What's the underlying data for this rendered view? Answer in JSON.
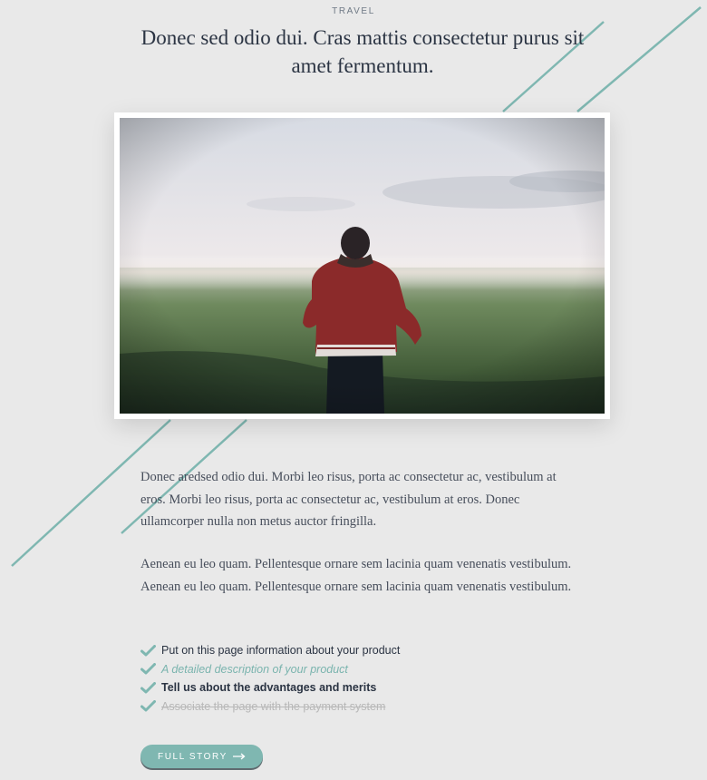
{
  "article": {
    "category": "TRAVEL",
    "headline": "Donec sed odio dui. Cras mattis consectetur purus sit amet fermentum.",
    "paragraphs": [
      "Donec aredsed odio dui. Morbi leo risus, porta ac consectetur ac, vestibulum at eros. Morbi leo risus, porta ac consectetur ac, vestibulum at eros. Donec ullamcorper nulla non metus auctor fringilla.",
      "Aenean eu leo quam. Pellentesque ornare sem lacinia quam venenatis vestibulum. Aenean eu leo quam. Pellentesque ornare sem lacinia quam venenatis vestibulum."
    ],
    "features": [
      "Put on this page information about your product",
      "A detailed description of your product",
      "Tell us about the advantages and merits",
      "Associate the page with the payment system"
    ],
    "button_label": "FULL STORY"
  },
  "icons": {
    "feature": "check-icon",
    "button": "arrow-right-icon"
  },
  "colors": {
    "accent": "#7fb7b1",
    "background": "#e9e9e9",
    "heading": "#2b3443"
  }
}
